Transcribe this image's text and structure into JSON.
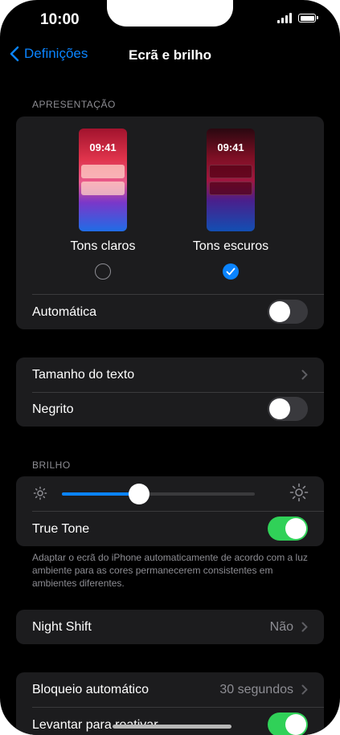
{
  "status_bar": {
    "time": "10:00"
  },
  "nav": {
    "back_label": "Definições",
    "title": "Ecrã e brilho"
  },
  "appearance": {
    "header": "APRESENTAÇÃO",
    "light": {
      "preview_time": "09:41",
      "label": "Tons claros",
      "selected": false
    },
    "dark": {
      "preview_time": "09:41",
      "label": "Tons escuros",
      "selected": true
    },
    "automatic": {
      "label": "Automática",
      "on": false
    }
  },
  "text_settings": {
    "text_size": {
      "label": "Tamanho do texto"
    },
    "bold": {
      "label": "Negrito",
      "on": false
    }
  },
  "brightness": {
    "header": "BRILHO",
    "level_percent": 40,
    "true_tone": {
      "label": "True Tone",
      "on": true
    },
    "footnote": "Adaptar o ecrã do iPhone automaticamente de acordo com a luz ambiente para as cores permanecerem consistentes em ambientes diferentes."
  },
  "night_shift": {
    "label": "Night Shift",
    "value": "Não"
  },
  "lock": {
    "auto_lock": {
      "label": "Bloqueio automático",
      "value": "30 segundos"
    },
    "raise_to_wake": {
      "label": "Levantar para reativar",
      "on": true
    }
  },
  "colors": {
    "accent": "#0a84ff",
    "toggle_on": "#30d158",
    "card_bg": "#1c1c1e"
  }
}
